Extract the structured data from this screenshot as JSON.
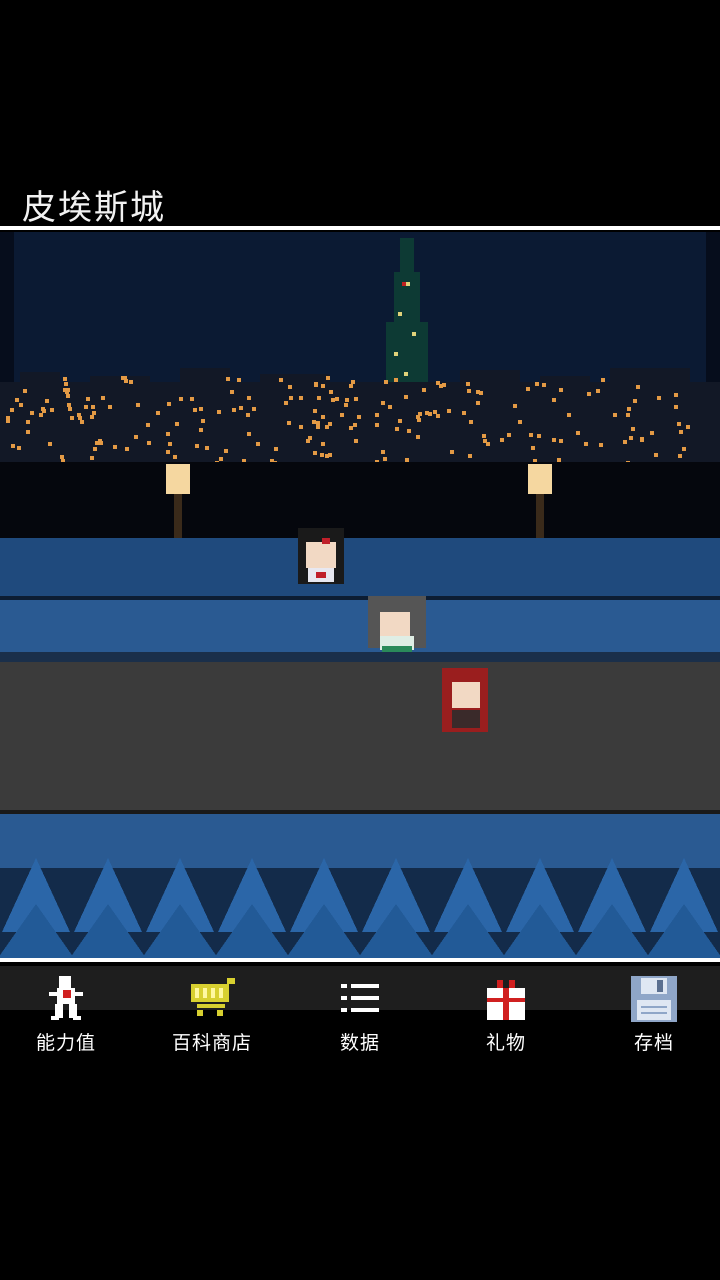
{
  "location": {
    "title": "皮埃斯城"
  },
  "scene": {
    "sky_color": "#0b1a33",
    "river_color": "#2a5a92",
    "road_color": "#3b3b3b",
    "tree_color": "#2b66a8",
    "characters": [
      {
        "name": "schoolgirl",
        "hair": "#1a1a1a",
        "accent": "#c0202a"
      },
      {
        "name": "grey-haired-girl",
        "hair": "#555555",
        "accent": "#2a8a5a"
      },
      {
        "name": "red-haired-girl",
        "hair": "#9a1e1e",
        "accent": "#3a2a2a"
      }
    ]
  },
  "menu": {
    "items": [
      {
        "label": "能力值",
        "icon": "person-icon"
      },
      {
        "label": "百科商店",
        "icon": "shopping-cart-icon"
      },
      {
        "label": "数据",
        "icon": "list-icon"
      },
      {
        "label": "礼物",
        "icon": "gift-icon"
      },
      {
        "label": "存档",
        "icon": "save-disk-icon"
      }
    ]
  }
}
